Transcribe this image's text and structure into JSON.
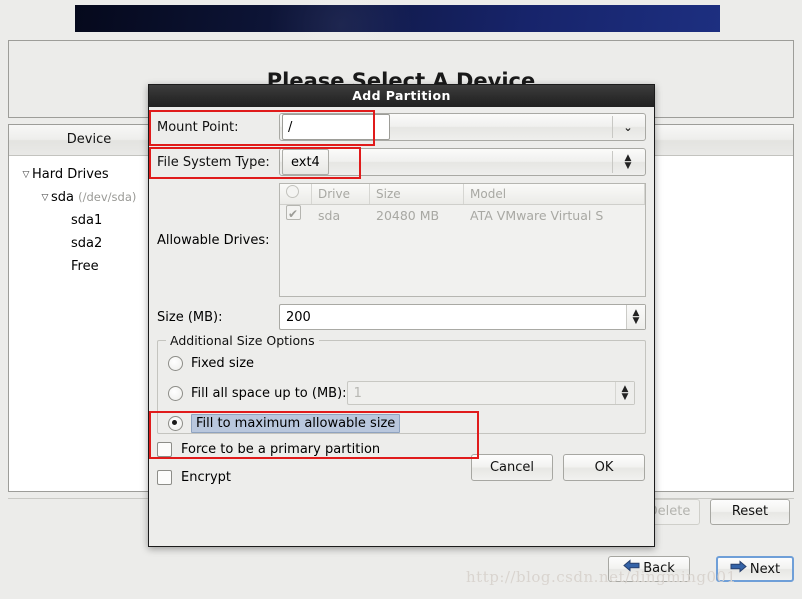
{
  "background": {
    "heading": "Please Select A Device",
    "tree": {
      "column_header": "Device",
      "nodes": [
        {
          "label": "Hard Drives",
          "detail": "",
          "level": 0,
          "expander": "▽"
        },
        {
          "label": "sda",
          "detail": "(/dev/sda)",
          "level": 1,
          "expander": "▽"
        },
        {
          "label": "sda1",
          "detail": "",
          "level": 2,
          "expander": ""
        },
        {
          "label": "sda2",
          "detail": "",
          "level": 2,
          "expander": ""
        },
        {
          "label": "Free",
          "detail": "",
          "level": 2,
          "expander": ""
        }
      ]
    },
    "buttons": {
      "delete": "Delete",
      "reset": "Reset",
      "back": "Back",
      "next": "Next"
    },
    "watermark": "http://blog.csdn.net/dingming001"
  },
  "dialog": {
    "title": "Add Partition",
    "mount_point": {
      "label": "Mount Point:",
      "value": "/",
      "dropdown_icon": "chevron-down-icon"
    },
    "file_system_type": {
      "label": "File System Type:",
      "value": "ext4",
      "spinner_icon": "updown-arrow-icon"
    },
    "allowable_drives": {
      "label": "Allowable Drives:",
      "columns": [
        "O",
        "Drive",
        "Size",
        "Model"
      ],
      "rows": [
        {
          "checked": true,
          "drive": "sda",
          "size": "20480 MB",
          "model": "ATA VMware Virtual S"
        }
      ]
    },
    "size": {
      "label": "Size (MB):",
      "value": "200"
    },
    "additional_size_options": {
      "title": "Additional Size Options",
      "options": [
        {
          "label": "Fixed size",
          "selected": false
        },
        {
          "label": "Fill all space up to (MB):",
          "selected": false,
          "field_value": "1",
          "field_disabled": true
        },
        {
          "label": "Fill to maximum allowable size",
          "selected": true,
          "focused": true
        }
      ]
    },
    "checkboxes": [
      {
        "label": "Force to be a primary partition",
        "checked": false
      },
      {
        "label": "Encrypt",
        "checked": false
      }
    ],
    "buttons": {
      "cancel": "Cancel",
      "ok": "OK"
    }
  },
  "annotations": {
    "accent_color": "#e01b1b",
    "boxes": [
      "mount-point-row",
      "file-system-type-row",
      "fill-to-maximum-row"
    ]
  }
}
